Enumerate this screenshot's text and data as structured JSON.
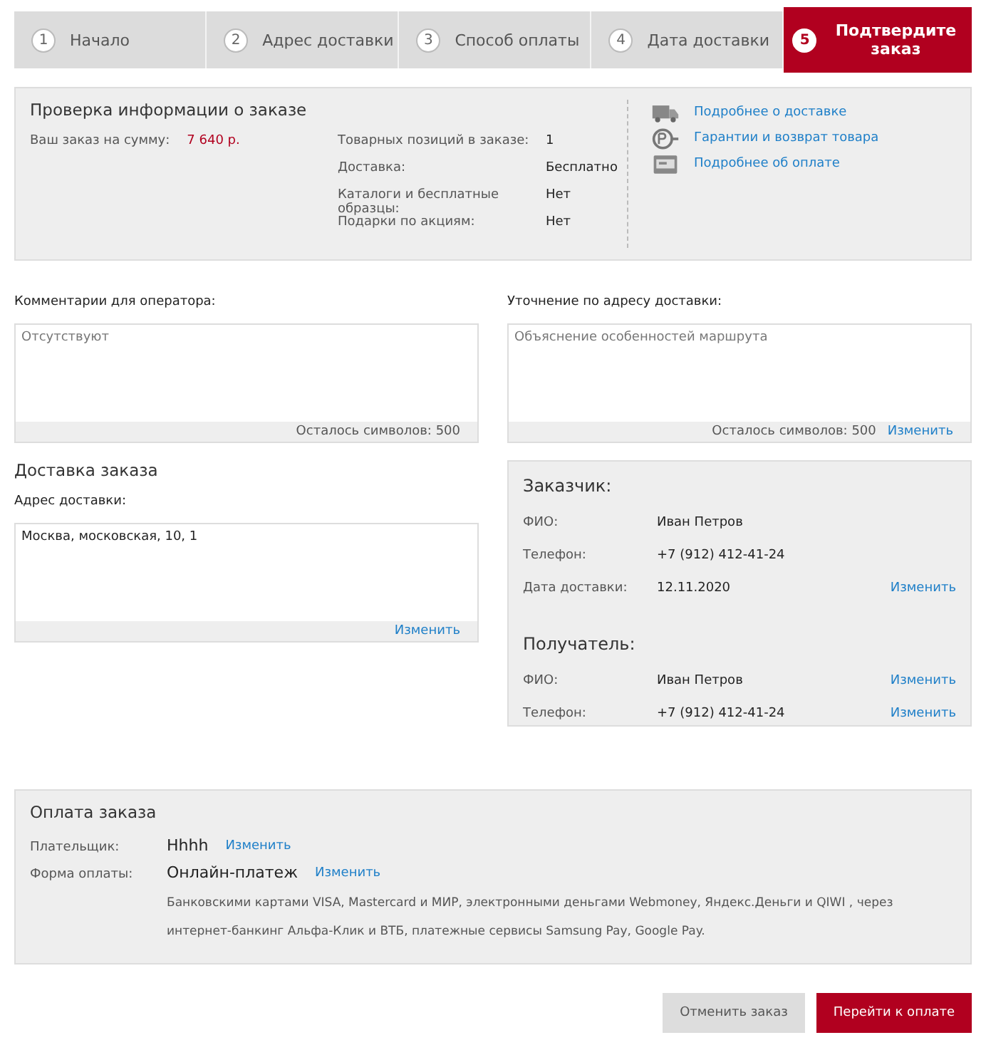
{
  "steps": [
    {
      "number": "1",
      "label": "Начало",
      "selected": false
    },
    {
      "number": "2",
      "label": "Адрес доставки",
      "selected": false
    },
    {
      "number": "3",
      "label": "Способ оплаты",
      "selected": false
    },
    {
      "number": "4",
      "label": "Дата доставки",
      "selected": false
    },
    {
      "number": "5",
      "label": "Подтвердите заказ",
      "selected": true
    }
  ],
  "summary": {
    "title": "Проверка информации о заказе",
    "total_label": "Ваш заказ на сумму:",
    "total_value": "7 640 р.",
    "details": [
      {
        "label": "Товарных позиций в заказе:",
        "value": "1"
      },
      {
        "label": "Доставка:",
        "value": "Бесплатно"
      },
      {
        "label": "Каталоги и бесплатные образцы:",
        "value": "Нет"
      },
      {
        "label": "Подарки по акциям:",
        "value": "Нет"
      }
    ],
    "links": [
      {
        "label": "Подробнее о доставке",
        "kind": "truck"
      },
      {
        "label": "Гарантии и возврат товара",
        "kind": "certificate"
      },
      {
        "label": "Подробнее об оплате",
        "kind": "card"
      }
    ]
  },
  "comments": [
    {
      "label": "Комментарии для оператора:",
      "placeholder": "Отсутствуют",
      "counter": "Осталось символов: 500"
    },
    {
      "label": "Уточнение по адресу доставки:",
      "placeholder": "Объяснение особенностей маршрута",
      "counter": "Осталось символов: 500",
      "change": "Изменить"
    }
  ],
  "delivery": {
    "title": "Доставка заказа",
    "address_label": "Адрес доставки:",
    "address_value": "Москва, московская, 10, 1",
    "change": "Изменить"
  },
  "people": [
    {
      "title": "Заказчик:",
      "rows": [
        {
          "label": "ФИО:",
          "value": "Иван Петров"
        },
        {
          "label": "Телефон:",
          "value": "+7 (912) 412-41-24"
        },
        {
          "label": "Дата доставки:",
          "value": "12.11.2020",
          "change": "Изменить"
        }
      ]
    },
    {
      "title": "Получатель:",
      "rows": [
        {
          "label": "ФИО:",
          "value": "Иван Петров",
          "change": "Изменить"
        },
        {
          "label": "Телефон:",
          "value": "+7 (912) 412-41-24",
          "change": "Изменить"
        }
      ]
    }
  ],
  "payment": {
    "title": "Оплата заказа",
    "rows": [
      {
        "label": "Плательщик:",
        "value": "Hhhh",
        "change": "Изменить"
      },
      {
        "label": "Форма оплаты:",
        "value": "Онлайн-платеж",
        "change": "Изменить",
        "description": "Банковскими картами VISA, Mastercard и МИР, электронными деньгами Webmoney, Яндекс.Деньги и QIWI , через интернет-банкинг Альфа-Клик и ВТБ, платежные сервисы Samsung Pay, Google Pay."
      }
    ]
  },
  "buttons": [
    {
      "label": "Отменить заказ",
      "kind": "secondary"
    },
    {
      "label": "Перейти к оплате",
      "kind": "primary"
    }
  ]
}
